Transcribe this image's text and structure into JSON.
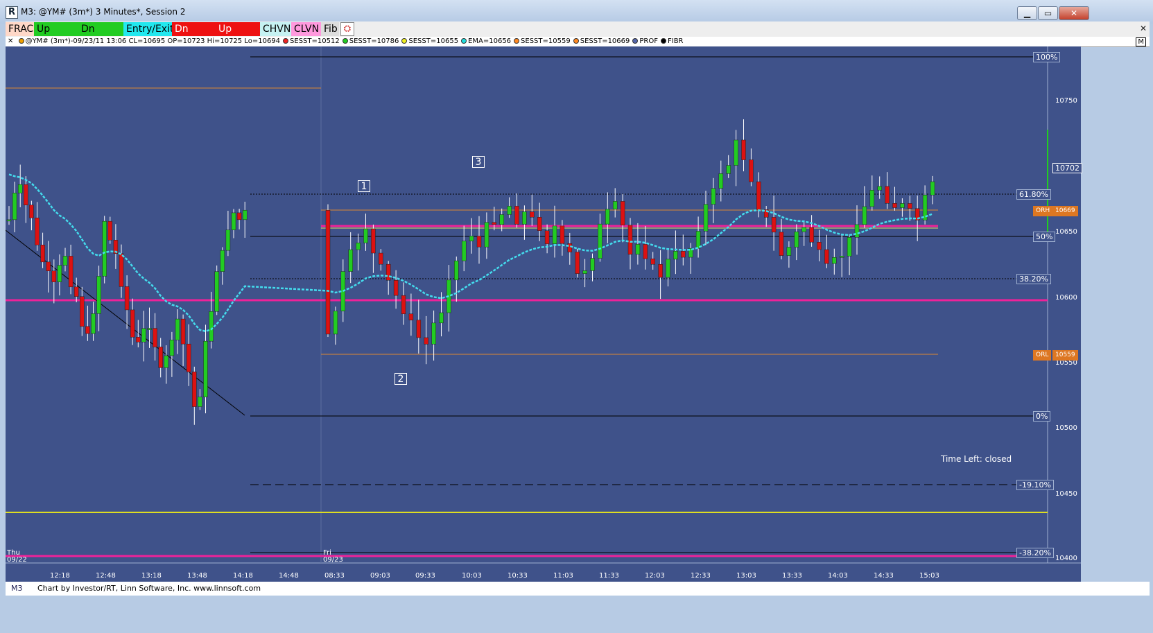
{
  "window": {
    "title": "M3: @YM# (3m*) 3 Minutes*, Session 2",
    "app_icon_letter": "R",
    "controls": {
      "minimize": "▁",
      "maximize": "▭",
      "close": "✕"
    }
  },
  "toolbar": {
    "buttons": [
      {
        "label": "FRAC",
        "bg": "#ffd8c8",
        "fg": "#000000"
      },
      {
        "label": "Up Arrow",
        "bg": "#22cc22",
        "fg": "#000000"
      },
      {
        "label": "Dn Arrow",
        "bg": "#22cc22",
        "fg": "#000000"
      },
      {
        "label": "Entry/Exit",
        "bg": "#22e8ee",
        "fg": "#000000"
      },
      {
        "label": "Dn Arrow",
        "bg": "#ee1111",
        "fg": "#ffffff"
      },
      {
        "label": "Up Arrow",
        "bg": "#ee1111",
        "fg": "#ffffff"
      },
      {
        "label": "CHVN",
        "bg": "#c6f2f2",
        "fg": "#000000"
      },
      {
        "label": "CLVN",
        "bg": "#ff99dd",
        "fg": "#000000"
      },
      {
        "label": "Fib",
        "bg": "#dddddd",
        "fg": "#000000"
      }
    ],
    "close_glyph": "✕"
  },
  "legend": {
    "close_glyph": "✕",
    "items": [
      {
        "text": "@YM# (3m*)-09/23/11 13:06 CL=10695 OP=10723 Hi=10725 Lo=10694",
        "color": "#f0a000"
      },
      {
        "text": "SESST=10512",
        "color": "#ee2222"
      },
      {
        "text": "SESST=10786",
        "color": "#22cc22"
      },
      {
        "text": "SESST=10655",
        "color": "#eeee22"
      },
      {
        "text": "EMA=10656",
        "color": "#22dddd"
      },
      {
        "text": "SESST=10559",
        "color": "#ff8822"
      },
      {
        "text": "SESST=10669",
        "color": "#ff8822"
      },
      {
        "text": "PROF",
        "color": "#5566aa"
      },
      {
        "text": "FIBR",
        "color": "#000000"
      }
    ],
    "m_box": "M"
  },
  "chart": {
    "background": "#3f528a",
    "price_axis": [
      "10750",
      "10700",
      "10650",
      "10600",
      "10550",
      "10500",
      "10450",
      "10400"
    ],
    "last_price": "10702",
    "fib_labels": [
      "100%",
      "61.80%",
      "50%",
      "38.20%",
      "0%",
      "-19.10%",
      "-38.20%"
    ],
    "orh": {
      "label": "ORH",
      "value": "10669"
    },
    "orl": {
      "label": "ORL",
      "value": "10559"
    },
    "time_left": "Time Left: closed",
    "time_labels": [
      "12:18",
      "12:48",
      "13:18",
      "13:48",
      "14:18",
      "14:48",
      "08:33",
      "09:03",
      "09:33",
      "10:03",
      "10:33",
      "11:03",
      "11:33",
      "12:03",
      "12:33",
      "13:03",
      "13:33",
      "14:03",
      "14:33",
      "15:03"
    ],
    "day_labels": [
      {
        "day": "Thu",
        "date": "09/22"
      },
      {
        "day": "Fri",
        "date": "09/23"
      }
    ],
    "count_labels": [
      "1",
      "2",
      "3"
    ],
    "colors": {
      "up": "#22cc22",
      "down": "#dd1111",
      "ema": "#44ddee",
      "pink": "#ee2299",
      "orange": "#dd8833",
      "yellow": "#dddd22",
      "wick": "#ffffff"
    }
  },
  "status": {
    "tab": "M3",
    "credit": "Chart by Investor/RT, Linn Software, Inc. www.linnsoft.com"
  }
}
